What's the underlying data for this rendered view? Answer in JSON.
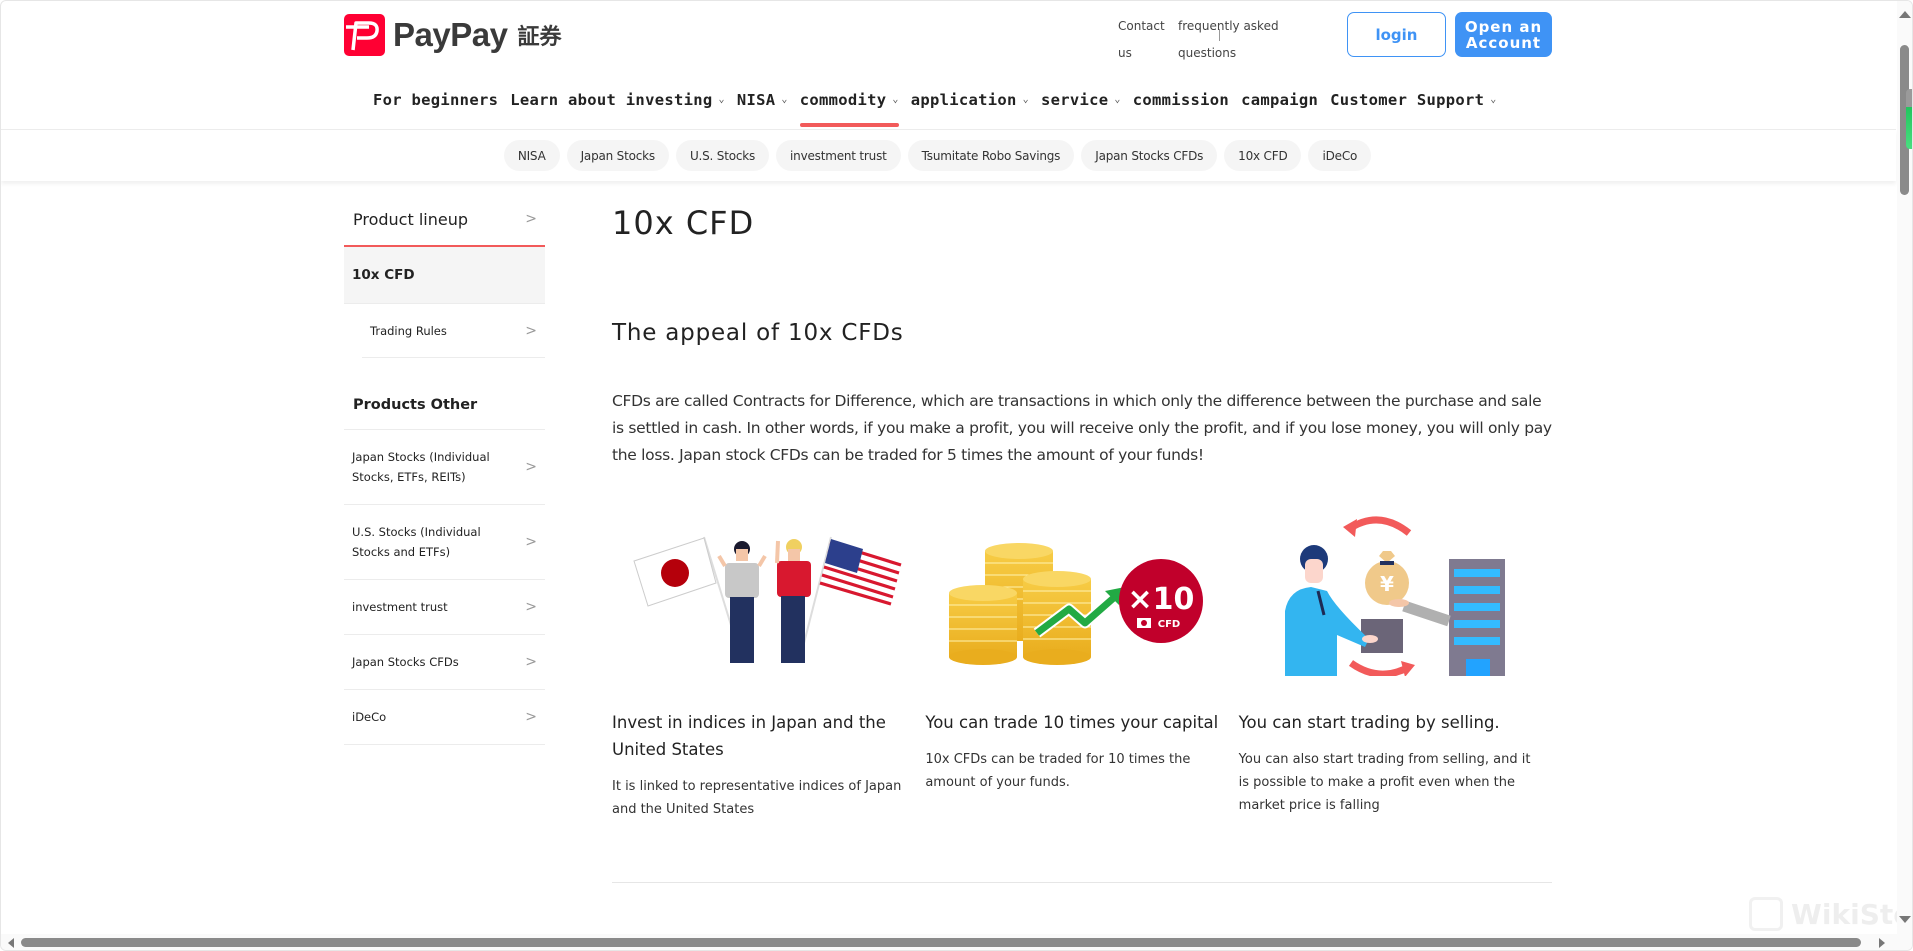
{
  "header": {
    "logo_text": "PayPay",
    "logo_suffix": "証券",
    "util_links": [
      {
        "label": "Contact us"
      },
      {
        "label": "frequently asked questions"
      }
    ],
    "login_label": "login",
    "open_account_label": "Open an Account"
  },
  "nav": {
    "items": [
      {
        "label": "For beginners",
        "has_dropdown": false
      },
      {
        "label": "Learn about investing",
        "has_dropdown": true
      },
      {
        "label": "NISA",
        "has_dropdown": true
      },
      {
        "label": "commodity",
        "has_dropdown": true,
        "active": true
      },
      {
        "label": "application",
        "has_dropdown": true
      },
      {
        "label": "service",
        "has_dropdown": true
      },
      {
        "label": "commission",
        "has_dropdown": false
      },
      {
        "label": "campaign",
        "has_dropdown": false
      },
      {
        "label": "Customer Support",
        "has_dropdown": true
      }
    ],
    "dropdown_glyph": "⌄"
  },
  "subnav": {
    "pills": [
      "NISA",
      "Japan Stocks",
      "U.S. Stocks",
      "investment trust",
      "Tsumitate Robo Savings",
      "Japan Stocks CFDs",
      "10x CFD",
      "iDeCo"
    ]
  },
  "sidebar": {
    "head_label": "Product lineup",
    "active_label": "10x CFD",
    "sub_items": [
      {
        "label": "Trading Rules"
      }
    ],
    "section_label": "Products Other",
    "links": [
      {
        "label": "Japan Stocks (Individual Stocks, ETFs, REITs)"
      },
      {
        "label": "U.S. Stocks (Individual Stocks and ETFs)"
      },
      {
        "label": "investment trust"
      },
      {
        "label": "Japan Stocks CFDs"
      },
      {
        "label": "iDeCo"
      }
    ],
    "chevron_glyph": ">"
  },
  "content": {
    "title": "10x CFD",
    "section_heading": "The appeal of 10x CFDs",
    "intro": "CFDs are called Contracts for Difference, which are transactions in which only the difference between the purchase and sale is settled in cash. In other words, if you make a profit, you will receive only the profit, and if you lose money, you will only pay the loss. Japan stock CFDs can be traded for 5 times the amount of your funds!",
    "cards": [
      {
        "illustration": "japan-us-flags-illustration",
        "title": "Invest in indices in Japan and the United States",
        "desc": "It is linked to representative indices of Japan and the United States"
      },
      {
        "illustration": "coins-x10-illustration",
        "badge_text": "×10",
        "badge_sub": "CFD",
        "title": "You can trade 10 times your capital",
        "desc": "10x CFDs can be traded for 10 times the amount of your funds."
      },
      {
        "illustration": "selling-trade-illustration",
        "title": "You can start trading by selling.",
        "desc": "You can also start trading from selling, and it is possible to make a profit even when the market price is falling"
      }
    ]
  },
  "watermark": "WikiStock",
  "colors": {
    "brand_red": "#ff0033",
    "accent_blue": "#3f93f5",
    "active_underline": "#f25a5a",
    "pill_bg": "#f5f5f5"
  }
}
